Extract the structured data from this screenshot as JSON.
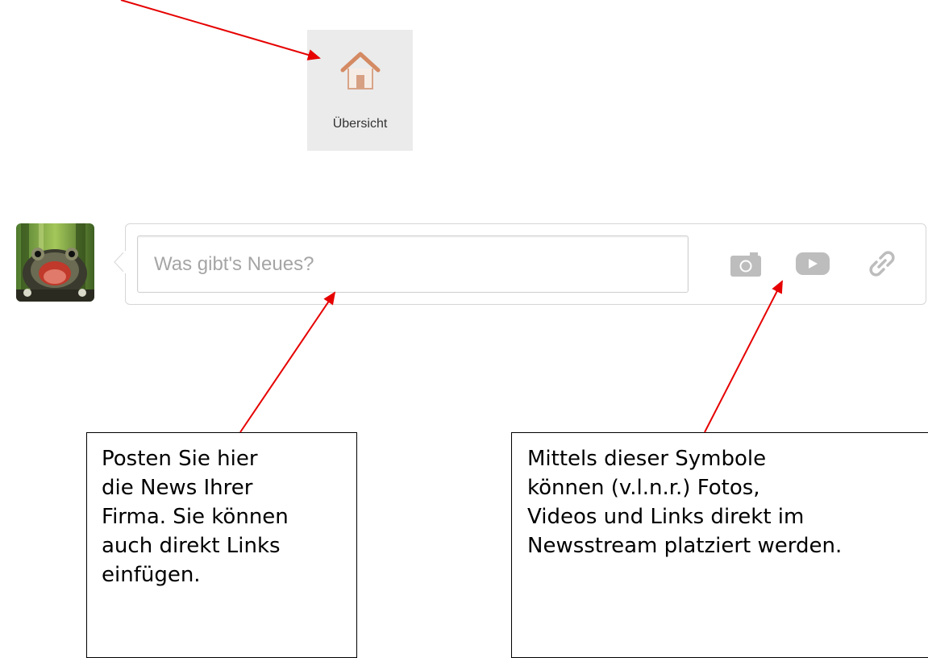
{
  "nav": {
    "overview_label": "Übersicht",
    "house_icon": "house-icon",
    "house_color": "#d48a63"
  },
  "composer": {
    "placeholder": "Was gibt's Neues?",
    "value": "",
    "icons": [
      "camera-icon",
      "video-play-icon",
      "link-icon"
    ],
    "icon_color": "#bdbdbd"
  },
  "avatar": {
    "icon": "avatar-frog-image"
  },
  "annotations": {
    "left": "Posten Sie hier\ndie News Ihrer\nFirma. Sie können\nauch direkt Links\neinfügen.",
    "right": "Mittels dieser Symbole\nkönnen (v.l.n.r.) Fotos,\nVideos und Links direkt im\nNewsstream platziert werden."
  },
  "colors": {
    "arrow": "#e60000",
    "tile_bg": "#ebebeb"
  }
}
